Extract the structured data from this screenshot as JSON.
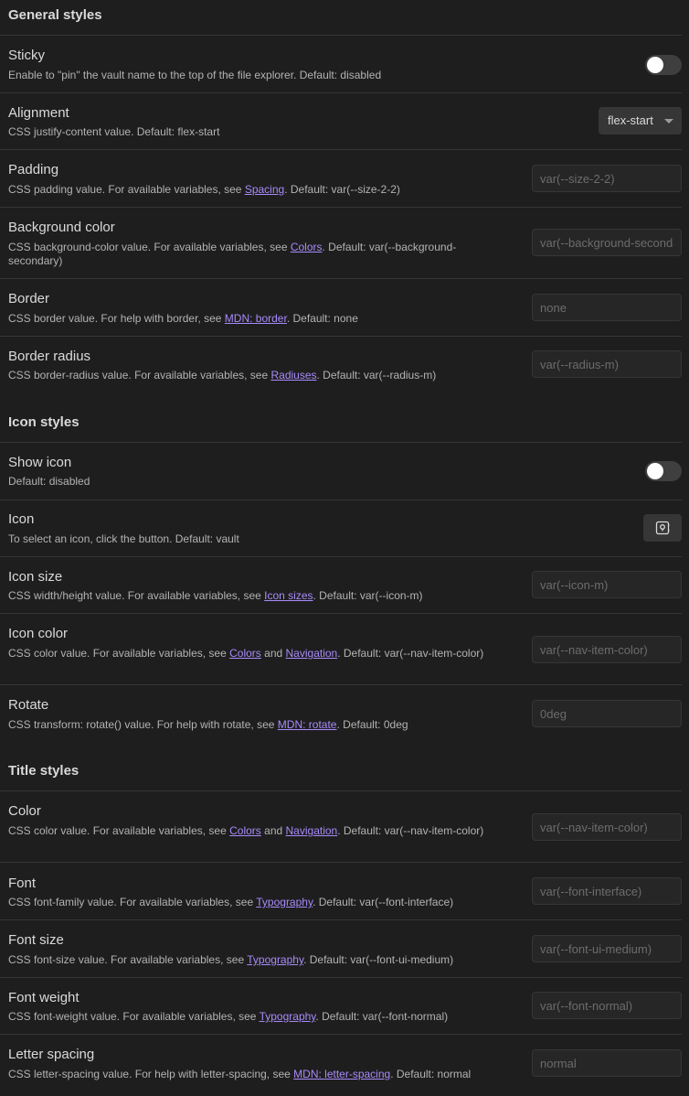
{
  "general": {
    "heading": "General styles",
    "sticky": {
      "name": "Sticky",
      "desc": "Enable to \"pin\" the vault name to the top of the file explorer. Default: disabled",
      "enabled": false
    },
    "alignment": {
      "name": "Alignment",
      "desc": "CSS justify-content value. Default: flex-start",
      "value": "flex-start"
    },
    "padding": {
      "name": "Padding",
      "desc_pre": "CSS padding value. For available variables, see ",
      "link": "Spacing",
      "desc_post": ". Default: var(--size-2-2)",
      "placeholder": "var(--size-2-2)"
    },
    "background_color": {
      "name": "Background color",
      "desc_pre": "CSS background-color value. For available variables, see ",
      "link": "Colors",
      "desc_post": ". Default: var(--background-secondary)",
      "placeholder": "var(--background-secondary)"
    },
    "border": {
      "name": "Border",
      "desc_pre": "CSS border value. For help with border, see ",
      "link": "MDN: border",
      "desc_post": ". Default: none",
      "placeholder": "none"
    },
    "border_radius": {
      "name": "Border radius",
      "desc_pre": "CSS border-radius value. For available variables, see ",
      "link": "Radiuses",
      "desc_post": ". Default: var(--radius-m)",
      "placeholder": "var(--radius-m)"
    }
  },
  "icon": {
    "heading": "Icon styles",
    "show_icon": {
      "name": "Show icon",
      "desc": "Default: disabled",
      "enabled": false
    },
    "icon": {
      "name": "Icon",
      "desc": "To select an icon, click the button. Default: vault",
      "icon_name": "vault-icon"
    },
    "icon_size": {
      "name": "Icon size",
      "desc_pre": "CSS width/height value. For available variables, see ",
      "link": "Icon sizes",
      "desc_post": ". Default: var(--icon-m)",
      "placeholder": "var(--icon-m)"
    },
    "icon_color": {
      "name": "Icon color",
      "desc_pre": "CSS color value. For available variables, see ",
      "link1": "Colors",
      "desc_mid": " and ",
      "link2": "Navigation",
      "desc_post": ". Default: var(--nav-item-color)",
      "placeholder": "var(--nav-item-color)"
    },
    "rotate": {
      "name": "Rotate",
      "desc_pre": "CSS transform: rotate() value. For help with rotate, see ",
      "link": "MDN: rotate",
      "desc_post": ". Default: 0deg",
      "placeholder": "0deg"
    }
  },
  "title": {
    "heading": "Title styles",
    "color": {
      "name": "Color",
      "desc_pre": "CSS color value. For available variables, see ",
      "link1": "Colors",
      "desc_mid": " and ",
      "link2": "Navigation",
      "desc_post": ". Default: var(--nav-item-color)",
      "placeholder": "var(--nav-item-color)"
    },
    "font": {
      "name": "Font",
      "desc_pre": "CSS font-family value. For available variables, see ",
      "link": "Typography",
      "desc_post": ". Default: var(--font-interface)",
      "placeholder": "var(--font-interface)"
    },
    "font_size": {
      "name": "Font size",
      "desc_pre": "CSS font-size value. For available variables, see ",
      "link": "Typography",
      "desc_post": ". Default: var(--font-ui-medium)",
      "placeholder": "var(--font-ui-medium)"
    },
    "font_weight": {
      "name": "Font weight",
      "desc_pre": "CSS font-weight value. For available variables, see ",
      "link": "Typography",
      "desc_post": ". Default: var(--font-normal)",
      "placeholder": "var(--font-normal)"
    },
    "letter_spacing": {
      "name": "Letter spacing",
      "desc_pre": "CSS letter-spacing value. For help with letter-spacing, see ",
      "link": "MDN: letter-spacing",
      "desc_post": ". Default: normal",
      "placeholder": "normal"
    }
  },
  "colors": {
    "background": "#1e1e1e",
    "accent_link": "#a88bfa",
    "input_background": "#262626",
    "toggle_off": "#3f3f3f"
  }
}
